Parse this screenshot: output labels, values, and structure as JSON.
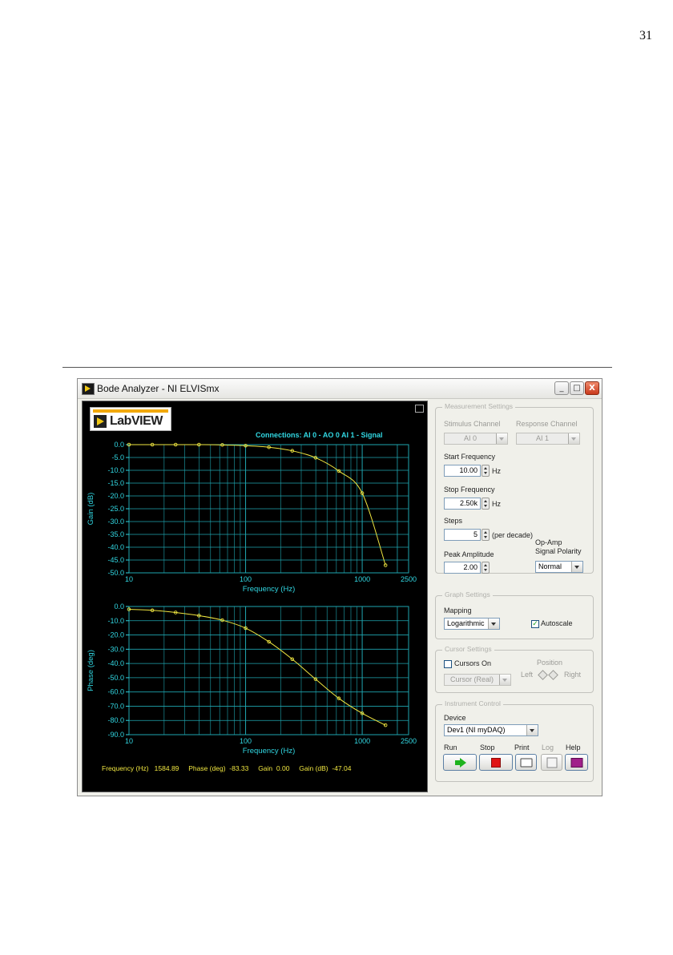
{
  "page": {
    "number": "31"
  },
  "window": {
    "title": "Bode Analyzer - NI ELVISmx",
    "controls": {
      "minimize": "_",
      "maximize": "□",
      "close": "X"
    }
  },
  "logo": {
    "text": "LabVIEW"
  },
  "graph_header": {
    "connections": "Connections: AI 0 - AO 0   AI 1 - Signal"
  },
  "readout": {
    "freq_label": "Frequency (Hz)",
    "freq_value": "1584.89",
    "phase_label": "Phase (deg)",
    "phase_value": "-83.33",
    "gain_label": "Gain",
    "gain_value": "0.00",
    "gaindb_label": "Gain (dB)",
    "gaindb_value": "-47.04"
  },
  "measurement": {
    "legend": "Measurement Settings",
    "stimulus_label": "Stimulus Channel",
    "stimulus_value": "AI 0",
    "response_label": "Response Channel",
    "response_value": "AI 1",
    "start_label": "Start Frequency",
    "start_value": "10.00",
    "start_unit": "Hz",
    "stop_label": "Stop Frequency",
    "stop_value": "2.50k",
    "stop_unit": "Hz",
    "steps_label": "Steps",
    "steps_value": "5",
    "steps_unit": "(per decade)",
    "peak_label": "Peak Amplitude",
    "peak_value": "2.00",
    "polarity_label_1": "Op-Amp",
    "polarity_label_2": "Signal Polarity",
    "polarity_value": "Normal"
  },
  "graph_settings": {
    "legend": "Graph Settings",
    "mapping_label": "Mapping",
    "mapping_value": "Logarithmic",
    "autoscale_label": "Autoscale",
    "autoscale_checked": true
  },
  "cursor_settings": {
    "legend": "Cursor Settings",
    "cursors_on_label": "Cursors On",
    "cursors_on_checked": false,
    "position_label": "Position",
    "left_label": "Left",
    "right_label": "Right",
    "cursor_value": "Cursor (Real)"
  },
  "instrument_control": {
    "legend": "Instrument Control",
    "device_label": "Device",
    "device_value": "Dev1 (NI myDAQ)",
    "run_label": "Run",
    "stop_label": "Stop",
    "print_label": "Print",
    "log_label": "Log",
    "help_label": "Help"
  },
  "colors": {
    "plot_bg": "#000000",
    "grid": "#1fa6b0",
    "trace": "#f0e640",
    "axis_text": "#31d7e2"
  },
  "icons": {
    "run": "run-arrow-icon",
    "stop": "stop-square-icon",
    "print": "printer-icon",
    "log": "log-icon",
    "help": "help-book-icon"
  },
  "chart_data": [
    {
      "type": "line",
      "xlabel": "Frequency (Hz)",
      "ylabel": "Gain (dB)",
      "xscale": "log",
      "xlim": [
        10,
        2500
      ],
      "ylim": [
        -50,
        0
      ],
      "x_ticks": [
        "10",
        "100",
        "1000",
        "2500"
      ],
      "y_ticks": [
        "0.0",
        "-5.0",
        "-10.0",
        "-15.0",
        "-20.0",
        "-25.0",
        "-30.0",
        "-35.0",
        "-40.0",
        "-45.0",
        "-50.0"
      ],
      "grid": true,
      "x": [
        10,
        15.85,
        25.12,
        39.81,
        63.1,
        100,
        158.5,
        251.2,
        398.1,
        631,
        1000,
        1584.89
      ],
      "y": [
        0.0,
        0.0,
        0.0,
        0.0,
        -0.1,
        -0.4,
        -1.0,
        -2.4,
        -5.1,
        -10.3,
        -18.9,
        -47.04
      ]
    },
    {
      "type": "line",
      "xlabel": "Frequency (Hz)",
      "ylabel": "Phase (deg)",
      "xscale": "log",
      "xlim": [
        10,
        2500
      ],
      "ylim": [
        -90,
        0
      ],
      "x_ticks": [
        "10",
        "100",
        "1000",
        "2500"
      ],
      "y_ticks": [
        "0.0",
        "-10.0",
        "-20.0",
        "-30.0",
        "-40.0",
        "-50.0",
        "-60.0",
        "-70.0",
        "-80.0",
        "-90.0"
      ],
      "grid": true,
      "x": [
        10,
        15.85,
        25.12,
        39.81,
        63.1,
        100,
        158.5,
        251.2,
        398.1,
        631,
        1000,
        1584.89
      ],
      "y": [
        -2.0,
        -2.7,
        -4.2,
        -6.4,
        -9.6,
        -15.2,
        -24.8,
        -37.0,
        -51.0,
        -64.5,
        -75.0,
        -83.33
      ]
    }
  ]
}
